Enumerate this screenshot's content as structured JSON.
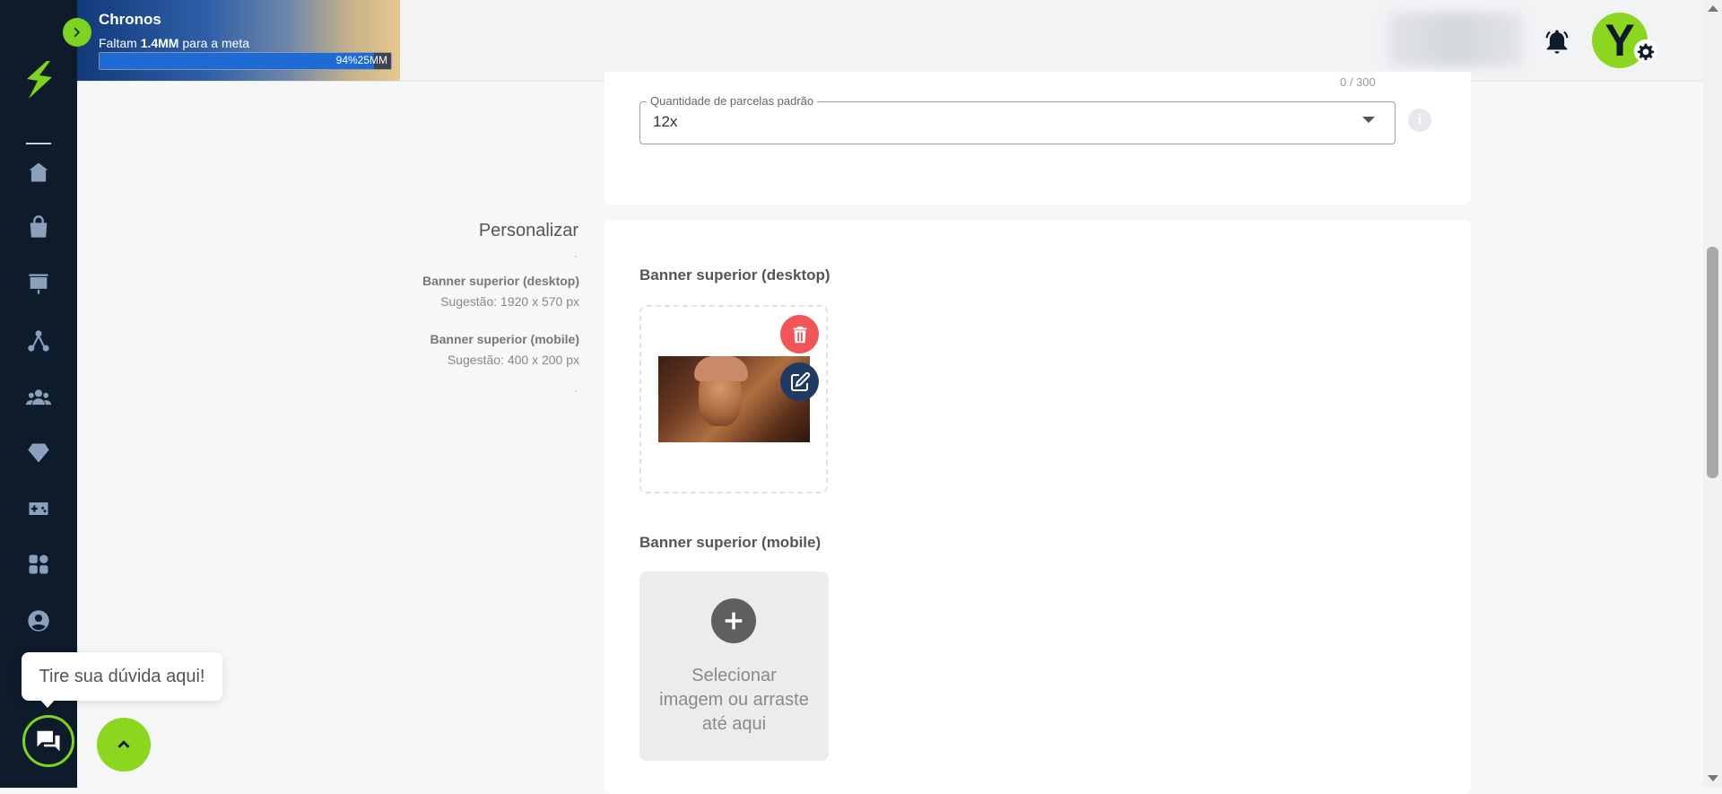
{
  "promo": {
    "title": "Chronos",
    "subtitle_prefix": "Faltam ",
    "subtitle_amount": "1.4MM",
    "subtitle_suffix": " para a meta",
    "progress_text": "94%25MM",
    "progress_value": 0.94
  },
  "form": {
    "char_count": "0 / 300",
    "installments_label": "Quantidade de parcelas padrão",
    "installments_value": "12x",
    "info_icon": "i"
  },
  "personalizar": {
    "title": "Personalizar",
    "dot1": "·",
    "dot2": "·",
    "help": [
      {
        "label": "Banner superior (desktop)",
        "hint": "Sugestão: 1920 x 570 px"
      },
      {
        "label": "Banner superior (mobile)",
        "hint": "Sugestão: 400 x 200 px"
      }
    ],
    "desktop_label": "Banner superior (desktop)",
    "mobile_label": "Banner superior (mobile)",
    "upload_text": "Selecionar imagem ou arraste até aqui"
  },
  "header": {
    "avatar_letter": "Y"
  },
  "chat": {
    "bubble_text": "Tire sua dúvida aqui!"
  },
  "colors": {
    "sidebar": "#0d1b2a",
    "accent_green": "#8bd61f",
    "delete_red": "#f25555",
    "edit_navy": "#1f3b63"
  }
}
